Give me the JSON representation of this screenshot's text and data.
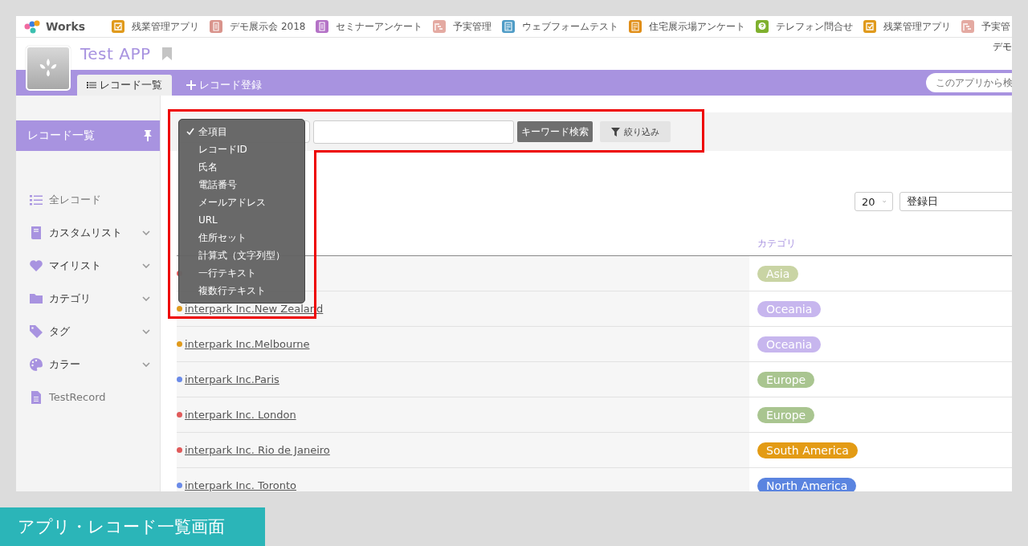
{
  "apps": [
    {
      "label": "残業管理アプリ",
      "kind": "check",
      "color": "#e09a1c"
    },
    {
      "label": "デモ展示会 2018",
      "kind": "doc",
      "color": "#d9948c"
    },
    {
      "label": "セミナーアンケート",
      "kind": "doc",
      "color": "#b472c6"
    },
    {
      "label": "予実管理",
      "kind": "gantt",
      "color": "#e4aaa2"
    },
    {
      "label": "ウェブフォームテスト",
      "kind": "form",
      "color": "#4f9cc6"
    },
    {
      "label": "住宅展示場アンケート",
      "kind": "form",
      "color": "#e08e18"
    },
    {
      "label": "テレフォン問合せ",
      "kind": "question",
      "color": "#7fb02e"
    },
    {
      "label": "残業管理アプリ",
      "kind": "check",
      "color": "#e09a1c"
    },
    {
      "label": "予実管",
      "kind": "gantt",
      "color": "#e4aaa2"
    }
  ],
  "logo_text": "Works",
  "user_label": "デモ",
  "app_title": "Test APP",
  "tabs": [
    {
      "label": "レコード一覧",
      "selected": true
    },
    {
      "label": "レコード登録",
      "selected": false
    }
  ],
  "app_search": {
    "placeholder": "このアプリから検"
  },
  "sidebar": {
    "header": "レコード一覧",
    "items": [
      {
        "label": "全レコード",
        "kind": "link"
      },
      {
        "label": "カスタムリスト",
        "kind": "group"
      },
      {
        "label": "マイリスト",
        "kind": "group"
      },
      {
        "label": "カテゴリ",
        "kind": "group"
      },
      {
        "label": "タグ",
        "kind": "group"
      },
      {
        "label": "カラー",
        "kind": "group"
      },
      {
        "label": "TestRecord",
        "kind": "link"
      }
    ]
  },
  "toolbar": {
    "search_button": "キーワード検索",
    "filter_button": "絞り込み"
  },
  "field_menu": [
    {
      "label": "全項目",
      "selected": true
    },
    {
      "label": "レコードID",
      "selected": false
    },
    {
      "label": "氏名",
      "selected": false
    },
    {
      "label": "電話番号",
      "selected": false
    },
    {
      "label": "メールアドレス",
      "selected": false
    },
    {
      "label": "URL",
      "selected": false
    },
    {
      "label": "住所セット",
      "selected": false
    },
    {
      "label": "計算式（文字列型）",
      "selected": false
    },
    {
      "label": "一行テキスト",
      "selected": false
    },
    {
      "label": "複数行テキスト",
      "selected": false
    }
  ],
  "per_page": "20",
  "sort": "登録日",
  "table": {
    "columns": [
      "カテゴリ"
    ],
    "rows": [
      {
        "color": "#e05a5a",
        "category": {
          "label": "Asia",
          "color": "#c9d4a4"
        }
      },
      {
        "name": "interpark Inc.New Zealand",
        "color": "#e09a1c",
        "category": {
          "label": "Oceania",
          "color": "#c7b6ee"
        }
      },
      {
        "name": "interpark Inc.Melbourne",
        "color": "#e09a1c",
        "category": {
          "label": "Oceania",
          "color": "#c7b6ee"
        }
      },
      {
        "name": "interpark Inc.Paris",
        "color": "#6a8ae8",
        "category": {
          "label": "Europe",
          "color": "#a9c590"
        }
      },
      {
        "name": "interpark Inc. London",
        "color": "#e05a5a",
        "category": {
          "label": "Europe",
          "color": "#a9c590"
        }
      },
      {
        "name": "interpark Inc. Rio de Janeiro",
        "color": "#e05a5a",
        "category": {
          "label": "South America",
          "color": "#e39b14"
        }
      },
      {
        "name": "interpark Inc. Toronto",
        "color": "#6a8ae8",
        "category": {
          "label": "North America",
          "color": "#5a84e0"
        }
      }
    ]
  },
  "caption": "アプリ・レコード一覧画面"
}
